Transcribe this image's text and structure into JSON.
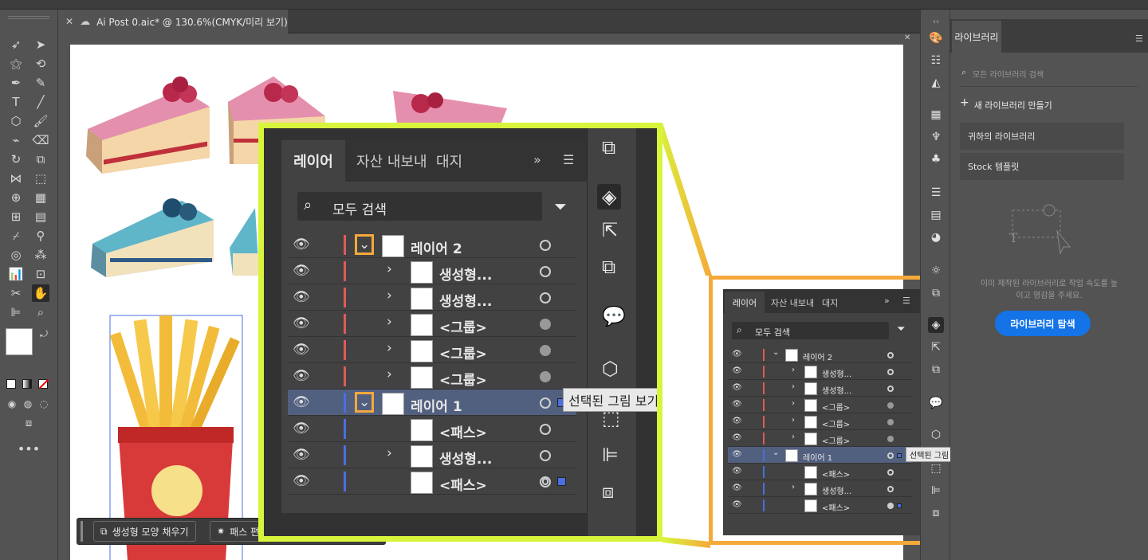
{
  "document": {
    "tab_title": "Ai Post 0.aic* @ 130.6%(CMYK/미리 보기)"
  },
  "libraries": {
    "tab": "라이브러리",
    "search_placeholder": "모든 라이브러리 검색",
    "new_library": "새 라이브러리 만들기",
    "your_libraries": "귀하의 라이브러리",
    "stock_templates": "Stock 템플릿",
    "empty_message_line1": "이미 제작된 라이브러리로 작업 속도를 높",
    "empty_message_line2": "이고 영감을 주세요.",
    "browse_button": "라이브러리 탐색"
  },
  "layers_panel": {
    "tabs": [
      "레이어",
      "자산 내보내",
      "대지"
    ],
    "search_placeholder": "모두 검색",
    "rows": [
      {
        "label": "레이어 2",
        "level": 0,
        "expanded": true,
        "color": "#e05a5a",
        "target": "circle"
      },
      {
        "label": "생성형...",
        "level": 1,
        "color": "#e05a5a",
        "target": "circle"
      },
      {
        "label": "생성형...",
        "level": 1,
        "color": "#e05a5a",
        "target": "circle"
      },
      {
        "label": "<그룹>",
        "level": 1,
        "color": "#e05a5a",
        "target": "filled"
      },
      {
        "label": "<그룹>",
        "level": 1,
        "color": "#e05a5a",
        "target": "filled"
      },
      {
        "label": "<그룹>",
        "level": 1,
        "color": "#e05a5a",
        "target": "filled"
      },
      {
        "label": "레이어 1",
        "level": 0,
        "expanded": true,
        "color": "#4a6fe0",
        "target": "circle",
        "selected": true
      },
      {
        "label": "<패스>",
        "level": 1,
        "color": "#4a6fe0",
        "target": "circle"
      },
      {
        "label": "생성형...",
        "level": 1,
        "color": "#4a6fe0",
        "target": "circle"
      },
      {
        "label": "<패스>",
        "level": 1,
        "color": "#4a6fe0",
        "target": "double"
      }
    ],
    "tooltip_zoom": "선택된 그림 보기",
    "tooltip_full": "선택된 그림 보기 (클릭하여 그림 선택)"
  },
  "bottom_bar": {
    "fill_button": "생성형 모양 채우기",
    "path_button": "패스 편"
  },
  "colors": {
    "accent_blue": "#1473e6",
    "zoom_frame": "#d8f53c",
    "orange_frame": "#f5a93a",
    "highlight_box": "#f5a93a"
  }
}
